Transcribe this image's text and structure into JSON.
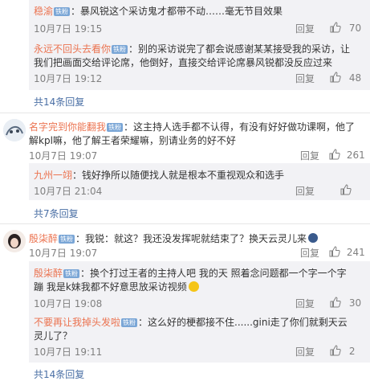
{
  "reply_action": "回复",
  "thread1": {
    "replies": [
      {
        "name": "稳渝",
        "badge": "铁粉",
        "text": "：暴风锐这个采访鬼才都带不动……毫无节目效果",
        "time": "10月7日 19:15",
        "likes": "70"
      },
      {
        "name": "永远不回头去看你",
        "badge": "铁粉",
        "text1": "：别的采访说完了都会说感谢某某接受我的采访，让",
        "text2": "我们把画面交给评论席，他倒好，直接交给评论席暴风锐都没反应过来",
        "time": "10月7日 19:12",
        "likes": "48"
      }
    ],
    "more": "共14条回复"
  },
  "comment2": {
    "name": "名字完到你能翻我",
    "badge": "铁粉",
    "text1": "：这主持人选手都不认得，有没有好好做功课啊，他了",
    "text2": "解kpl嘛，他了解王者荣耀嘛，别请业务的好不好",
    "time": "10月7日 19:07",
    "likes": "261"
  },
  "thread2": {
    "replies": [
      {
        "name": "九州一翊",
        "text": "：钱好挣所以随便找人就是根本不重视观众和选手",
        "time": "10月7日 21:04",
        "likes": ""
      }
    ],
    "more": "共7条回复"
  },
  "comment3": {
    "name": "殷柒醉",
    "badge": "铁粉",
    "text": "：我锐：就这？我还没发挥呢就结束了？换天云灵儿来",
    "time": "10月7日 19:07",
    "likes": "241"
  },
  "thread3": {
    "replies": [
      {
        "name": "殷柒醉",
        "badge": "铁粉",
        "text1": "：换个打过王者的主持人吧 我的天 照着念问题都一个字一个字",
        "text2": "蹦 我是k妹我都不好意思放采访视频",
        "time": "10月7日 19:08",
        "likes": "30"
      },
      {
        "name": "不要再让我掉头发啦",
        "badge": "铁粉",
        "text1": "：这么好的梗都接不住......gini走了你们就剩天云",
        "text2": "灵儿了？",
        "time": "10月7日 19:11",
        "likes": "2"
      }
    ],
    "more": "共14条回复"
  }
}
